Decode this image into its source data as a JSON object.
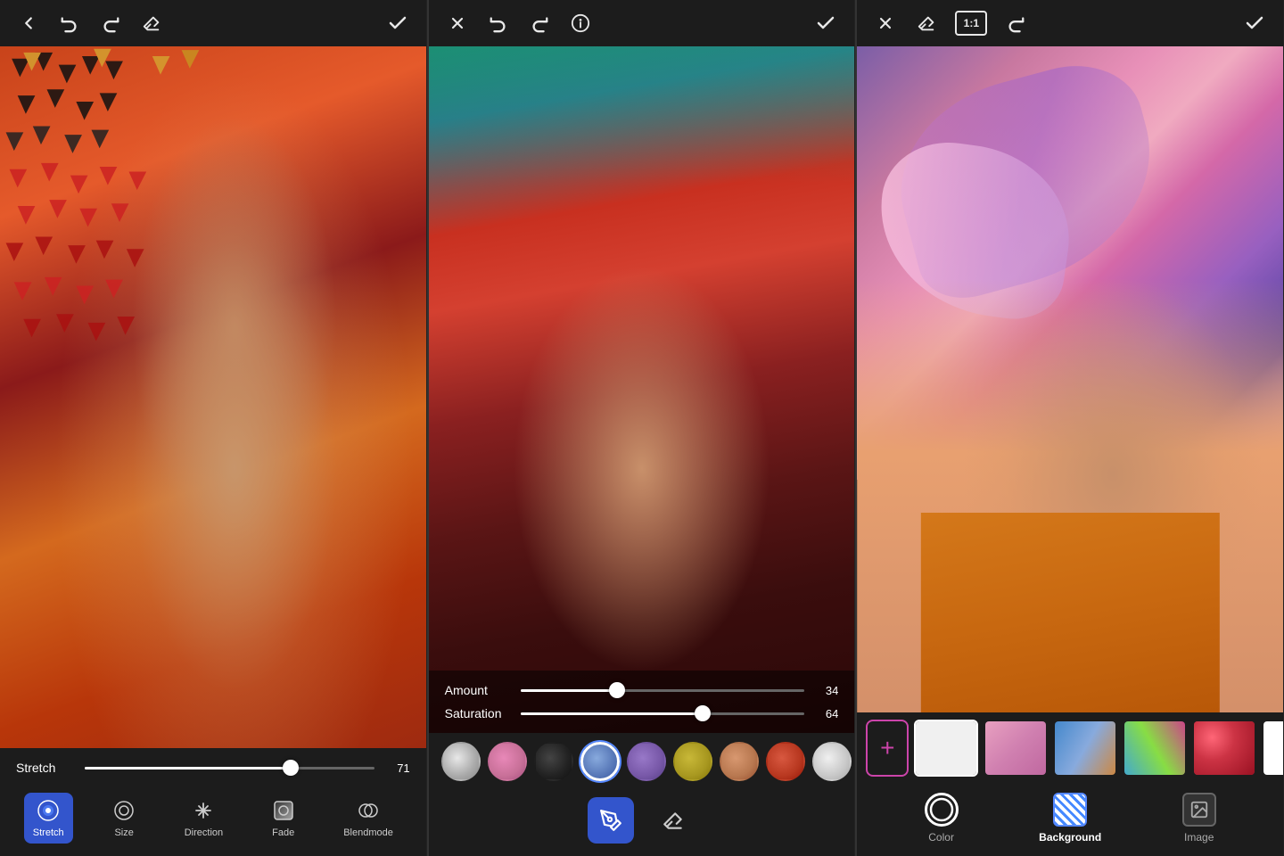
{
  "panels": [
    {
      "id": "panel1",
      "topbar": {
        "back_icon": "←",
        "undo_icon": "↺",
        "redo_icon": "↻",
        "eraser_icon": "eraser",
        "check_icon": "✓"
      },
      "slider": {
        "label": "Stretch",
        "value": 71,
        "percent": 71
      },
      "tools": [
        {
          "id": "stretch",
          "label": "Stretch",
          "active": true,
          "icon": "stretch"
        },
        {
          "id": "size",
          "label": "Size",
          "active": false,
          "icon": "size"
        },
        {
          "id": "direction",
          "label": "Direction",
          "active": false,
          "icon": "direction"
        },
        {
          "id": "fade",
          "label": "Fade",
          "active": false,
          "icon": "fade"
        },
        {
          "id": "blendmode",
          "label": "Blendmode",
          "active": false,
          "icon": "blendmode"
        }
      ]
    },
    {
      "id": "panel2",
      "topbar": {
        "close_icon": "✕",
        "undo_icon": "↺",
        "redo_icon": "↻",
        "info_icon": "ⓘ",
        "check_icon": "✓"
      },
      "sliders": [
        {
          "label": "Amount",
          "value": 34,
          "percent": 34
        },
        {
          "label": "Saturation",
          "value": 64,
          "percent": 64
        }
      ],
      "swatches": [
        {
          "id": "sw1",
          "color": "#c8c8c8",
          "selected": false
        },
        {
          "id": "sw2",
          "color": "#c878a0",
          "selected": false
        },
        {
          "id": "sw3",
          "color": "#1a1a1a",
          "selected": false
        },
        {
          "id": "sw4",
          "color": "#5878c8",
          "selected": true
        },
        {
          "id": "sw5",
          "color": "#7860b0",
          "selected": false
        },
        {
          "id": "sw6",
          "color": "#9a8820",
          "selected": false
        },
        {
          "id": "sw7",
          "color": "#b87850",
          "selected": false
        },
        {
          "id": "sw8",
          "color": "#c83820",
          "selected": false
        },
        {
          "id": "sw9",
          "color": "#b8b8b8",
          "selected": false
        }
      ],
      "draw_tools": [
        {
          "id": "brush",
          "active": true,
          "icon": "✏"
        },
        {
          "id": "eraser",
          "active": false,
          "icon": "◻"
        }
      ]
    },
    {
      "id": "panel3",
      "topbar": {
        "close_icon": "✕",
        "eraser_icon": "eraser",
        "ratio_icon": "1:1",
        "rotate_icon": "↻",
        "check_icon": "✓"
      },
      "thumbnails": [
        {
          "id": "th1",
          "type": "white-pattern",
          "selected": true
        },
        {
          "id": "th2",
          "type": "abstract-pink",
          "selected": false
        },
        {
          "id": "th3",
          "type": "abstract-blue",
          "selected": false
        },
        {
          "id": "th4",
          "type": "abstract-colorful",
          "selected": false
        },
        {
          "id": "th5",
          "type": "floral-red",
          "selected": false
        },
        {
          "id": "th6",
          "type": "white-plain",
          "selected": false
        },
        {
          "id": "th7",
          "type": "text-pattern",
          "selected": false
        }
      ],
      "modes": [
        {
          "id": "color",
          "label": "Color",
          "type": "circle"
        },
        {
          "id": "background",
          "label": "Background",
          "type": "hatched"
        },
        {
          "id": "image",
          "label": "Image",
          "type": "image"
        }
      ]
    }
  ]
}
